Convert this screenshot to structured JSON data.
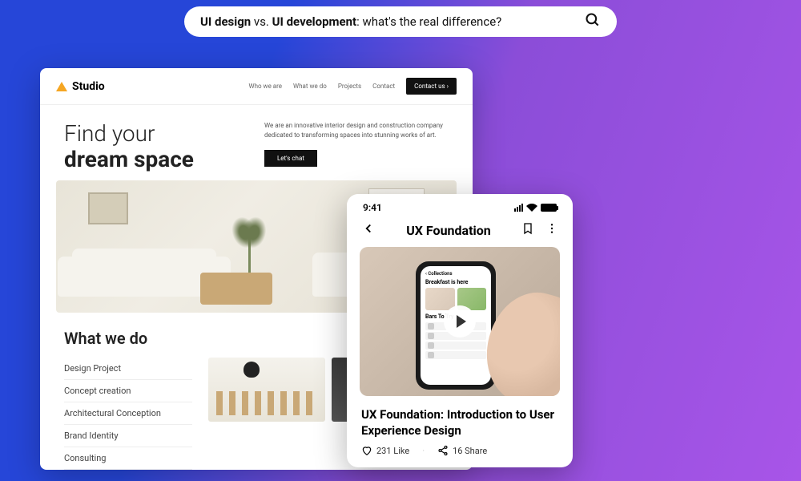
{
  "search": {
    "text_prefix_bold": "UI design",
    "text_vs": " vs. ",
    "text_mid_bold": "UI development",
    "text_suffix": ": what's the real difference?"
  },
  "website": {
    "brand": "Studio",
    "nav": {
      "item1": "Who we are",
      "item2": "What we do",
      "item3": "Projects",
      "item4": "Contact",
      "cta": "Contact us ›"
    },
    "hero": {
      "line1": "Find your",
      "line2": "dream space",
      "tagline": "We are an innovative interior design and construction company dedicated to transforming spaces into stunning works of art.",
      "cta": "Let's chat"
    },
    "what_we_do": {
      "heading": "What we do",
      "items": {
        "0": "Design Project",
        "1": "Concept creation",
        "2": "Architectural Conception",
        "3": "Brand Identity",
        "4": "Consulting"
      }
    }
  },
  "phone": {
    "time": "9:41",
    "app_title": "UX Foundation",
    "inner": {
      "back": "‹ Collections",
      "heading": "Breakfast is here",
      "section": "Bars To Try"
    },
    "article_title": "UX Foundation: Introduction to User Experience Design",
    "likes": "231 Like",
    "shares": "16 Share"
  }
}
